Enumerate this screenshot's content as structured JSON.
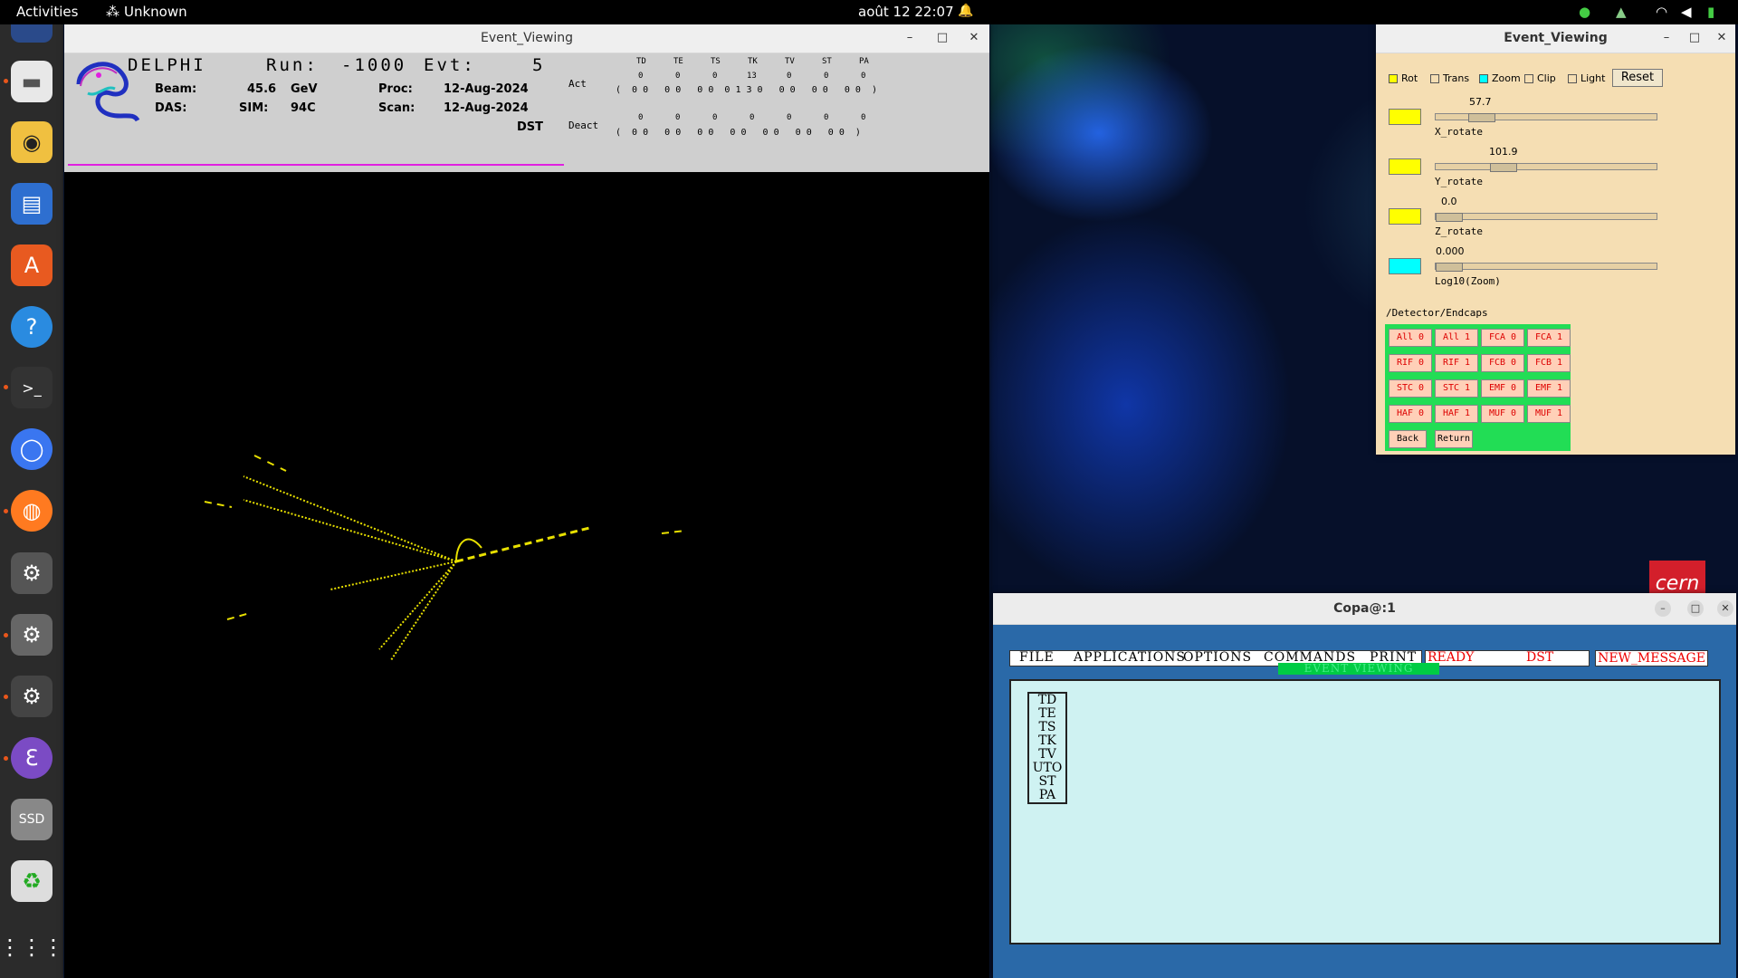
{
  "topbar": {
    "activities": "Activities",
    "app": "Unknown",
    "clock": "août 12  22:07"
  },
  "dock": {
    "ssd_label": "SSD"
  },
  "wallpaper": {
    "logo_text": "cern"
  },
  "ev_main": {
    "title": "Event_Viewing",
    "experiment": "DELPHI",
    "run_label": "Run:",
    "run_value": "-1000",
    "evt_label": "Evt:",
    "evt_value": "5",
    "beam_label": "Beam:",
    "beam_value": "45.6",
    "beam_unit": "GeV",
    "das_label": "DAS:",
    "sim_label": "SIM:",
    "sim_value": "94C",
    "proc_label": "Proc:",
    "proc_value": "12-Aug-2024",
    "scan_label": "Scan:",
    "scan_value": "12-Aug-2024",
    "dst_label": "DST",
    "det_cols": [
      "TD",
      "TE",
      "TS",
      "TK",
      "TV",
      "ST",
      "PA"
    ],
    "act_label": "Act",
    "act_values": [
      "0",
      "0",
      "0",
      "13",
      "0",
      "0",
      "0"
    ],
    "act_sub": "(  0 0   0 0   0 0  0 1 3 0   0 0   0 0   0 0  )",
    "deact_label": "Deact",
    "deact_values": [
      "0",
      "0",
      "0",
      "0",
      "0",
      "0",
      "0"
    ],
    "deact_sub": "(  0 0   0 0   0 0   0 0   0 0   0 0   0 0  )"
  },
  "ev_ctrl": {
    "title": "Event_Viewing",
    "checks": [
      {
        "label": "Rot",
        "checked": true
      },
      {
        "label": "Trans",
        "checked": false
      },
      {
        "label": "Zoom",
        "checked": true
      },
      {
        "label": "Clip",
        "checked": false
      },
      {
        "label": "Light",
        "checked": false
      }
    ],
    "reset_label": "Reset",
    "sliders": [
      {
        "label": "X_rotate",
        "value": "57.7",
        "color": "#ffff00",
        "fraction": 0.19
      },
      {
        "label": "Y_rotate",
        "value": "101.9",
        "color": "#ffff00",
        "fraction": 0.28
      },
      {
        "label": "Z_rotate",
        "value": "0.0",
        "color": "#ffff00",
        "fraction": 0.0
      },
      {
        "label": "Log10(Zoom)",
        "value": "0.000",
        "color": "#00ffff",
        "fraction": 0.0
      }
    ],
    "path": "/Detector/Endcaps",
    "buttons": [
      [
        "All 0",
        "All 1",
        "FCA 0",
        "FCA 1"
      ],
      [
        "RIF 0",
        "RIF 1",
        "FCB 0",
        "FCB 1"
      ],
      [
        "STC 0",
        "STC 1",
        "EMF 0",
        "EMF 1"
      ],
      [
        "HAF 0",
        "HAF 1",
        "MUF 0",
        "MUF 1"
      ]
    ],
    "back_label": "Back",
    "return_label": "Return"
  },
  "copa": {
    "title": "Copa@:1",
    "menu": [
      "FILE",
      "APPLICATIONS",
      "OPTIONS",
      "COMMANDS",
      "PRINT"
    ],
    "status_ready": "READY",
    "status_mode": "DST",
    "new_message": "NEW_MESSAGE",
    "active_app": "EVENT VIEWING",
    "detectors": [
      "TD",
      "TE",
      "TS",
      "TK",
      "TV",
      "UTO",
      "ST",
      "PA"
    ]
  }
}
